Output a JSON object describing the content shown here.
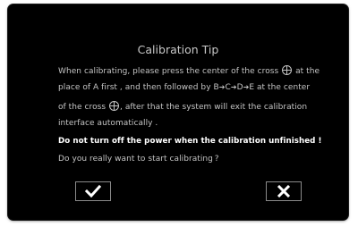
{
  "dialog": {
    "title": "Calibration Tip",
    "line1_a": "When calibrating, please press the center of the cross",
    "line1_b": "at the",
    "line2_a": "place of A first , and then followed by B",
    "line2_c": "C",
    "line2_d": "D",
    "line2_e": "E at the center",
    "line3_a": "of the cross",
    "line3_b": ", after that the system will exit the calibration",
    "line4": "interface automatically .",
    "warning": "Do not turn off the power when the calibration unfinished !",
    "question": "Do you really want to start calibrating ?"
  },
  "buttons": {
    "confirm_icon": "check-icon",
    "cancel_icon": "x-icon"
  }
}
